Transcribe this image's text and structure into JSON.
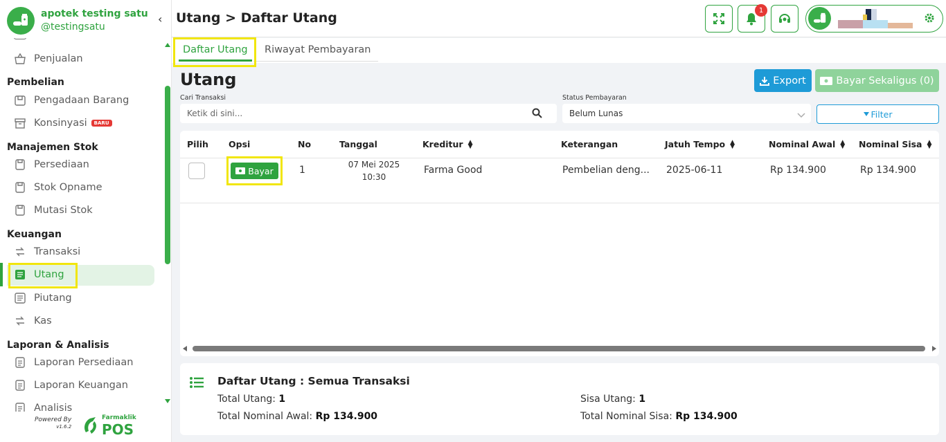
{
  "brand": {
    "name": "apotek testing satu",
    "handle": "@testingsatu"
  },
  "colors": {
    "primary": "#2fa33f",
    "info": "#1e9bd7",
    "danger": "#e53935",
    "highlight": "#f1e60c"
  },
  "sidebar": {
    "sections": [
      {
        "title": "Pembelian",
        "items": [
          {
            "label": "Pengadaan Barang",
            "icon": "inbox-icon"
          },
          {
            "label": "Konsinyasi",
            "icon": "box-icon",
            "badge": "BARU"
          }
        ]
      },
      {
        "title": "Manajemen Stok",
        "items": [
          {
            "label": "Persediaan",
            "icon": "clipboard-icon"
          },
          {
            "label": "Stok Opname",
            "icon": "clipboard-icon"
          },
          {
            "label": "Mutasi Stok",
            "icon": "clipboard-icon"
          }
        ]
      },
      {
        "title": "Keuangan",
        "items": [
          {
            "label": "Transaksi",
            "icon": "exchange-icon"
          },
          {
            "label": "Utang",
            "icon": "receipt-icon",
            "active": true
          },
          {
            "label": "Piutang",
            "icon": "receipt-icon"
          },
          {
            "label": "Kas",
            "icon": "exchange-icon"
          }
        ]
      },
      {
        "title": "Laporan & Analisis",
        "items": [
          {
            "label": "Laporan Persediaan",
            "icon": "document-icon"
          },
          {
            "label": "Laporan Keuangan",
            "icon": "document-icon"
          },
          {
            "label": "Analisis",
            "icon": "document-icon"
          }
        ]
      }
    ],
    "top_item": {
      "label": "Penjualan",
      "icon": "basket-icon"
    },
    "powered_by": "Powered By",
    "version": "v1.6.2",
    "footer_logo_small": "Farmaklik",
    "footer_logo_big": "POS"
  },
  "header": {
    "title": "Utang > Daftar Utang",
    "notification_count": "1"
  },
  "tabs": [
    {
      "label": "Daftar Utang",
      "active": true
    },
    {
      "label": "Riwayat Pembayaran",
      "active": false
    }
  ],
  "main": {
    "title": "Utang",
    "export_label": "Export",
    "bayar_sekaligus_label": "Bayar Sekaligus (0)",
    "search_label": "Cari Transaksi",
    "search_placeholder": "Ketik di sini...",
    "status_label": "Status Pembayaran",
    "status_value": "Belum Lunas",
    "filter_label": "Filter"
  },
  "table": {
    "columns": [
      "Pilih",
      "Opsi",
      "No",
      "Tanggal",
      "Kreditur",
      "Keterangan",
      "Jatuh Tempo",
      "Nominal Awal",
      "Nominal Sisa"
    ],
    "rows": [
      {
        "action": "Bayar",
        "no": "1",
        "tanggal_date": "07 Mei 2025",
        "tanggal_time": "10:30",
        "kreditur": "Farma Good",
        "keterangan": "Pembelian deng...",
        "jatuh_tempo": "2025-06-11",
        "nominal_awal": "Rp 134.900",
        "nominal_sisa": "Rp 134.900"
      }
    ]
  },
  "summary": {
    "title": "Daftar Utang : Semua Transaksi",
    "total_utang_label": "Total Utang:",
    "total_utang_value": "1",
    "sisa_utang_label": "Sisa Utang:",
    "sisa_utang_value": "1",
    "total_nominal_awal_label": "Total Nominal Awal:",
    "total_nominal_awal_value": "Rp 134.900",
    "total_nominal_sisa_label": "Total Nominal Sisa:",
    "total_nominal_sisa_value": "Rp 134.900"
  }
}
